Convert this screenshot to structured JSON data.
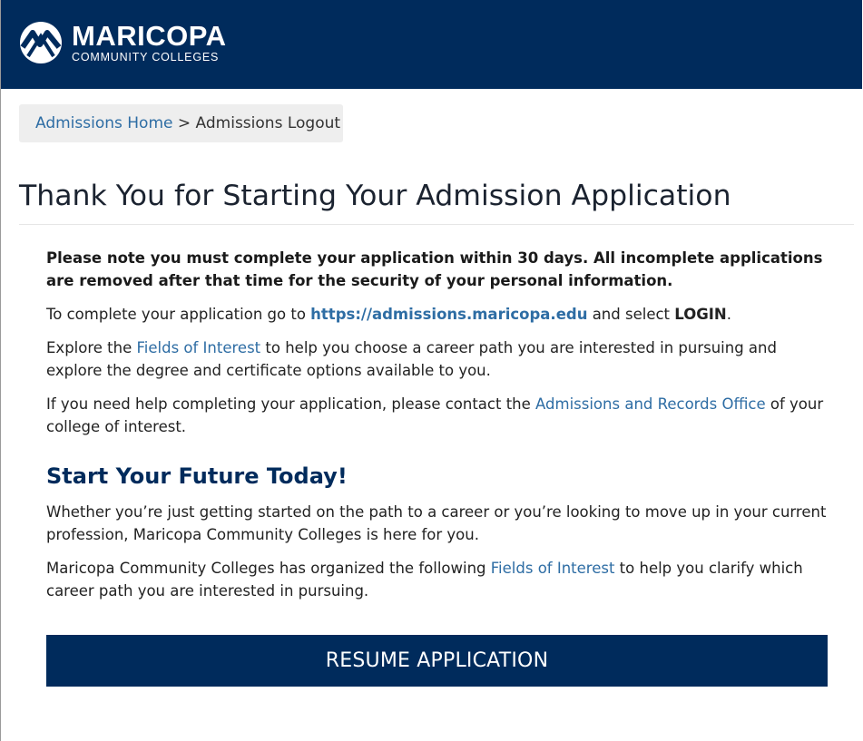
{
  "header": {
    "logo_name": "MARICOPA",
    "logo_sub": "COMMUNITY COLLEGES",
    "logo_icon": "maricopa-m-logo-icon"
  },
  "breadcrumb": {
    "home_label": "Admissions Home",
    "separator": ">",
    "current_label": "Admissions Logout"
  },
  "page_title": "Thank You for Starting Your Admission Application",
  "content": {
    "notice": "Please note you must complete your application within 30 days. All incomplete applications are removed after that time for the security of your personal information.",
    "complete_pre": "To complete your application go to ",
    "complete_url": "https://admissions.maricopa.edu",
    "complete_mid": " and select ",
    "complete_login": "LOGIN",
    "complete_end": ".",
    "explore_pre": "Explore the ",
    "explore_link": "Fields of Interest",
    "explore_post": " to help you choose a career path you are interested in pursuing and explore the degree and certificate options available to you.",
    "help_pre": "If you need help completing your application, please contact the ",
    "help_link": "Admissions and Records Office",
    "help_post": " of your college of interest.",
    "future_heading": "Start Your Future Today!",
    "future_text": "Whether you’re just getting started on the path to a career or you’re looking to move up in your current profession, Maricopa Community Colleges is here for you.",
    "organized_pre": "Maricopa Community Colleges has organized the following ",
    "organized_link": "Fields of Interest",
    "organized_post": " to help you clarify which career path you are interested in pursuing."
  },
  "resume_button_label": "RESUME APPLICATION",
  "colors": {
    "brand_navy": "#002b5c",
    "link_blue": "#2e6da4",
    "breadcrumb_bg": "#eeeeee"
  }
}
